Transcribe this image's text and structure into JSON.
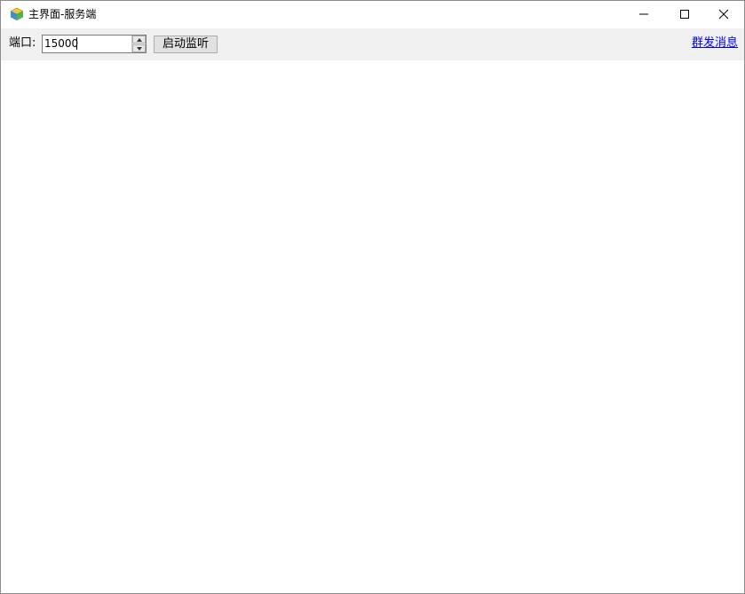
{
  "window": {
    "title": "主界面-服务端",
    "controls": {
      "minimize": "minimize-icon",
      "maximize": "maximize-icon",
      "close": "close-icon"
    }
  },
  "toolbar": {
    "port_label": "端口:",
    "port_value": "15000",
    "start_button_label": "启动监听",
    "broadcast_link_label": "群发消息"
  },
  "colors": {
    "toolbar_bg": "#f0f0f0",
    "link": "#0000ff",
    "button_bg": "#e1e1e1"
  }
}
